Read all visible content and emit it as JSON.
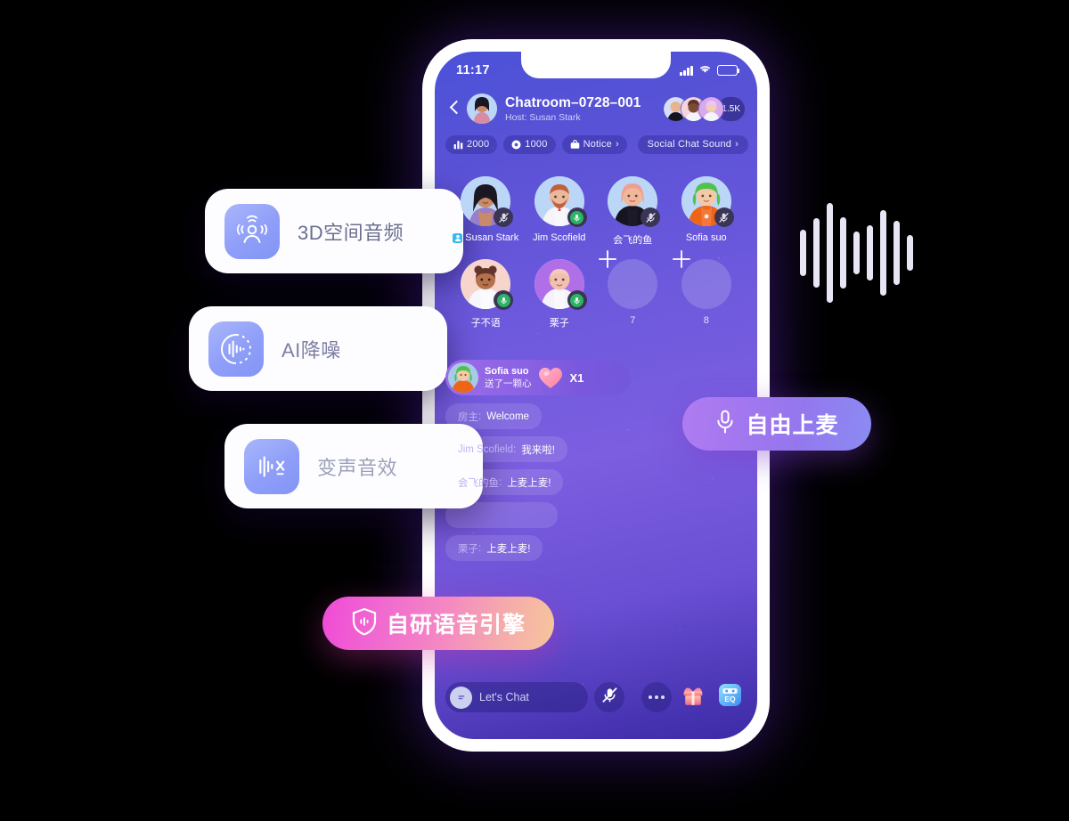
{
  "background": {
    "color": "#000000",
    "glow": "#3c1678"
  },
  "phone": {
    "frame_color": "#ffffff",
    "screen_gradient": [
      "#4b52d8",
      "#7c5ee0",
      "#3b2aa5"
    ]
  },
  "status_bar": {
    "time": "11:17",
    "signal_icon": "signal-bars-icon",
    "wifi_icon": "wifi-icon",
    "battery_icon": "battery-icon"
  },
  "room_header": {
    "back_icon": "chevron-left-icon",
    "host_avatar": "host-avatar",
    "title": "Chatroom–0728–001",
    "host_label": "Host: Susan Stark",
    "member_count": "1.5K",
    "member_avatars": [
      "member-avatar-1",
      "member-avatar-2",
      "member-avatar-3"
    ]
  },
  "chips": [
    {
      "icon": "rank-icon",
      "value": "2000",
      "name": "chip-rank"
    },
    {
      "icon": "coin-icon",
      "value": "1000",
      "name": "chip-coin"
    },
    {
      "icon": "notice-icon",
      "value": "Notice",
      "name": "chip-notice",
      "arrow": "›"
    }
  ],
  "chip_sound": {
    "label": "Social Chat Sound",
    "arrow": "›"
  },
  "seats": [
    {
      "name": "Susan Stark",
      "host": true,
      "mic": "mute",
      "index": "1",
      "occupied": true,
      "skin": "#c98a6a",
      "hair": "#1a1622",
      "shirt": "#9a7fc8"
    },
    {
      "name": "Jim Scofield",
      "host": false,
      "mic": "live",
      "index": "2",
      "occupied": true,
      "skin": "#eab89a",
      "hair": "#c1603a",
      "shirt": "#f4f4fa"
    },
    {
      "name": "会飞的鱼",
      "host": false,
      "mic": "mute",
      "index": "3",
      "occupied": true,
      "skin": "#f0b79a",
      "hair": "#ef9f8e",
      "shirt": "#161420"
    },
    {
      "name": "Sofia suo",
      "host": false,
      "mic": "mute",
      "index": "4",
      "occupied": true,
      "skin": "#f3c9a8",
      "hair": "#4fc24f",
      "shirt": "#ef6516"
    },
    {
      "name": "子不语",
      "host": false,
      "mic": "live",
      "index": "5",
      "occupied": true,
      "skin": "#b5714c",
      "hair": "#63342a",
      "shirt": "#f7f7fb"
    },
    {
      "name": "栗子",
      "host": false,
      "mic": "live",
      "index": "6",
      "occupied": true,
      "skin": "#f0c0b0",
      "hair": "#f0c0b0",
      "shirt": "#f3f3f9"
    },
    {
      "name": "",
      "host": false,
      "mic": "none",
      "index": "7",
      "occupied": false
    },
    {
      "name": "",
      "host": false,
      "mic": "none",
      "index": "8",
      "occupied": false
    }
  ],
  "gift_banner": {
    "sender": "Sofia suo",
    "action": "送了一颗心",
    "gift_icon": "heart-gift-icon",
    "multiplier": "X1"
  },
  "chat_messages": [
    {
      "from": "房主",
      "sep": ":",
      "body": "Welcome",
      "blank": false
    },
    {
      "from": "Jim Scofield",
      "sep": ":",
      "body": "我来啦!",
      "blank": false
    },
    {
      "from": "会飞的鱼",
      "sep": ":",
      "body": "上麦上麦!",
      "blank": false
    },
    {
      "from": "",
      "sep": "",
      "body": "",
      "blank": true
    },
    {
      "from": "栗子",
      "sep": ":",
      "body": "上麦上麦!",
      "blank": false
    }
  ],
  "toolbar": {
    "input_icon": "chat-bubble-icon",
    "input_placeholder": "Let's Chat",
    "mic_icon": "mic-muted-icon",
    "more_icon": "more-dots-icon",
    "gift_icon": "gift-box-icon",
    "eq_icon": "eq-icon",
    "eq_label": "EQ"
  },
  "feature_cards": [
    {
      "id": "card-3d",
      "icon": "spatial-audio-icon",
      "label": "3D空间音频"
    },
    {
      "id": "card-ai",
      "icon": "noise-reduction-icon",
      "label": "AI降噪"
    },
    {
      "id": "card-voice",
      "icon": "voice-changer-icon",
      "label": "变声音效"
    }
  ],
  "badges": [
    {
      "id": "badge-free-mic",
      "icon": "microphone-icon",
      "label": "自由上麦",
      "color_from": "#b07cf0",
      "color_to": "#8a8cf3"
    },
    {
      "id": "badge-engine",
      "icon": "shield-voice-icon",
      "label": "自研语音引擎",
      "color_from": "#ef4bd6",
      "color_to": "#f6c69c"
    }
  ],
  "waveform": {
    "bar_color": "#e8e6f5",
    "heights": [
      52,
      78,
      112,
      80,
      48,
      62,
      96,
      72,
      40
    ]
  }
}
